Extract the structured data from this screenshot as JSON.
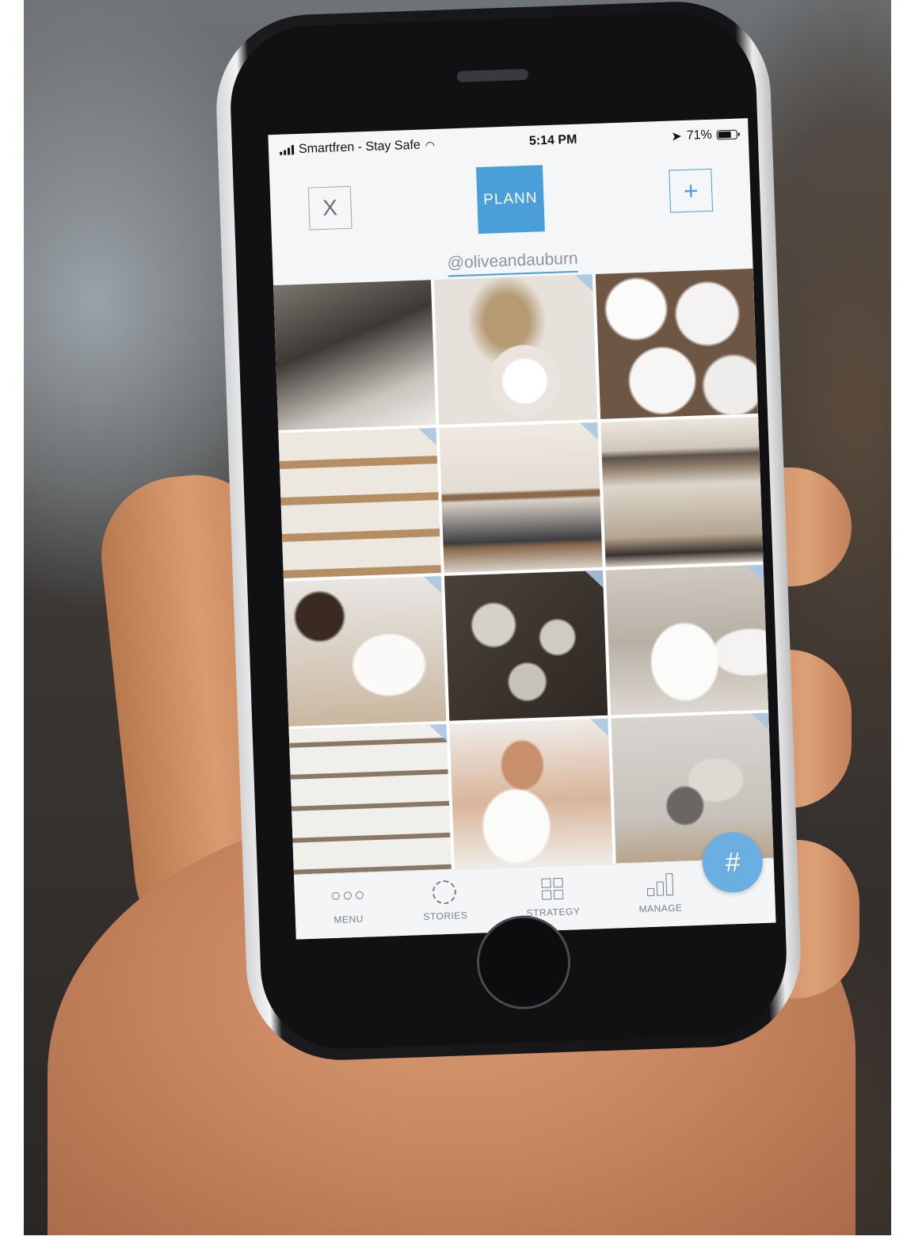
{
  "status_bar": {
    "carrier": "Smartfren - Stay Safe",
    "time": "5:14 PM",
    "battery": "71%",
    "battery_level": 0.71,
    "icons": [
      "signal-icon",
      "wifi-icon",
      "location-arrow-icon",
      "battery-icon"
    ]
  },
  "header": {
    "close_label": "X",
    "logo_text": "PLANN",
    "add_label": "+",
    "username": "@oliveandauburn",
    "accent_color": "#4a9fd8"
  },
  "grid": {
    "tiles": [
      {
        "subject": "woman-stacking-plates"
      },
      {
        "subject": "dried-grass-in-ring-vase"
      },
      {
        "subject": "white-cups-overhead"
      },
      {
        "subject": "wooden-shelves-with-pottery"
      },
      {
        "subject": "shelf-with-black-jug"
      },
      {
        "subject": "dark-bowls-on-wooden-stand"
      },
      {
        "subject": "woman-painting-ceramics"
      },
      {
        "subject": "ceramic-teapots"
      },
      {
        "subject": "stacked-white-bowls"
      },
      {
        "subject": "pottery-shop-shelves"
      },
      {
        "subject": "hands-holding-white-bowl"
      },
      {
        "subject": "grey-bottle-vase"
      }
    ]
  },
  "tabbar": {
    "tabs": [
      {
        "label": "MENU",
        "icon": "more-dots-icon"
      },
      {
        "label": "STORIES",
        "icon": "stories-ring-icon"
      },
      {
        "label": "STRATEGY",
        "icon": "grid-icon"
      },
      {
        "label": "MANAGE",
        "icon": "bar-chart-icon"
      }
    ],
    "fab_label": "#"
  }
}
